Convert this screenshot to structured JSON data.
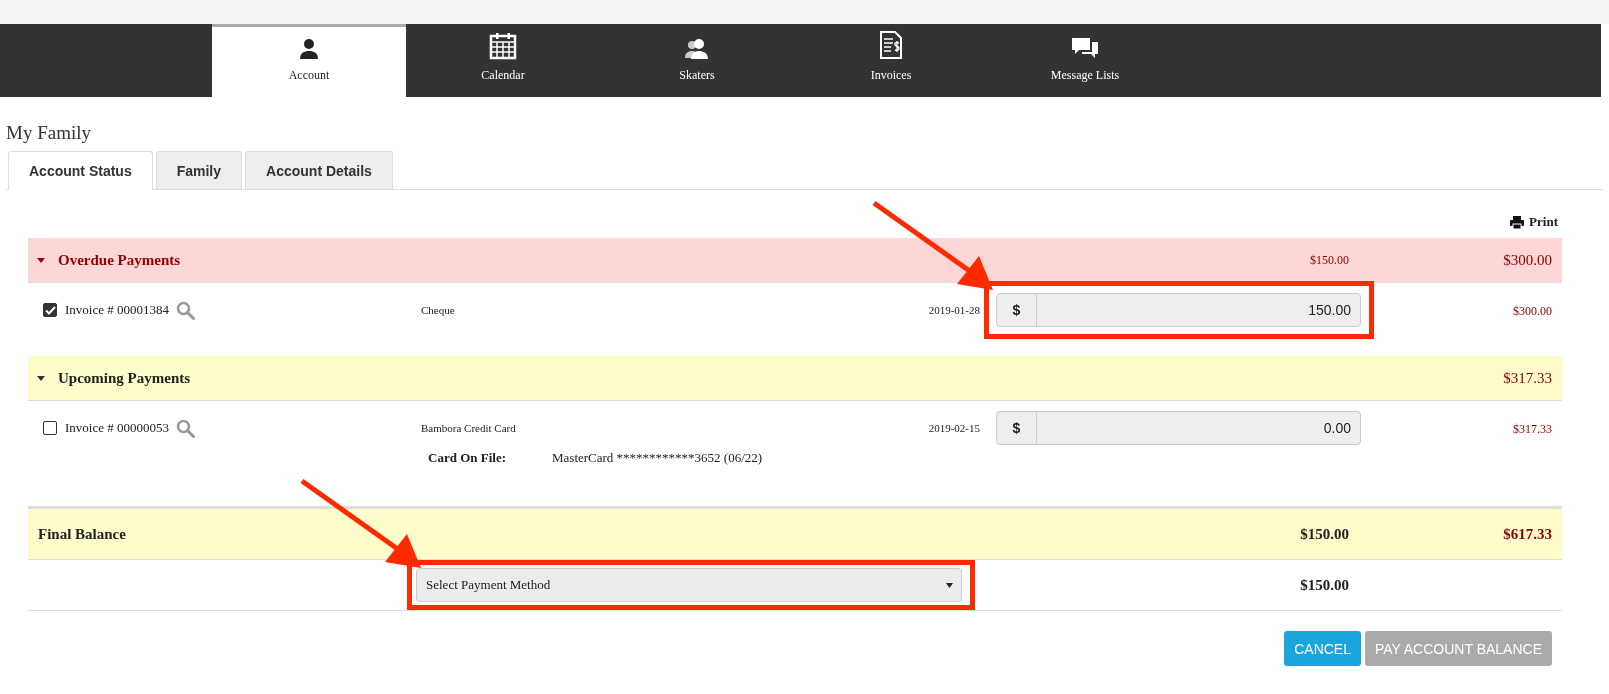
{
  "nav": [
    {
      "label": "Account",
      "kind": "person",
      "selected": true
    },
    {
      "label": "Calendar",
      "kind": "calendar",
      "selected": false
    },
    {
      "label": "Skaters",
      "kind": "people",
      "selected": false
    },
    {
      "label": "Invoices",
      "kind": "invoice",
      "selected": false
    },
    {
      "label": "Message Lists",
      "kind": "chat",
      "selected": false
    }
  ],
  "page_title": "My Family",
  "tabs": [
    {
      "label": "Account Status",
      "selected": true
    },
    {
      "label": "Family",
      "selected": false
    },
    {
      "label": "Account Details",
      "selected": false
    }
  ],
  "print_label": "Print",
  "sections": [
    {
      "kind": "overdue",
      "title": "Overdue Payments",
      "expanded": true,
      "selected_total": "$150.00",
      "total": "$300.00",
      "invoices": [
        {
          "label": "Invoice # 00001384",
          "checked": true,
          "method": "Cheque",
          "date": "2019-01-28",
          "currency": "$",
          "payment": "150.00",
          "amount": "$300.00",
          "highlighted": true
        }
      ]
    },
    {
      "kind": "upcoming",
      "title": "Upcoming Payments",
      "expanded": true,
      "total": "$317.33",
      "invoices": [
        {
          "label": "Invoice # 00000053",
          "checked": false,
          "method": "Bambora Credit Card",
          "date": "2019-02-15",
          "currency": "$",
          "payment": "0.00",
          "amount": "$317.33",
          "highlighted": false,
          "card_label": "Card On File:",
          "card_value": "MasterCard ************3652 (06/22)"
        }
      ]
    }
  ],
  "final_balance": {
    "label": "Final Balance",
    "paying": "$150.00",
    "total": "$617.33"
  },
  "payment_method": {
    "placeholder": "Select Payment Method",
    "highlighted": true,
    "amount": "$150.00"
  },
  "buttons": [
    {
      "label": "CANCEL",
      "disabled": false
    },
    {
      "label": "PAY ACCOUNT BALANCE",
      "disabled": true
    }
  ]
}
